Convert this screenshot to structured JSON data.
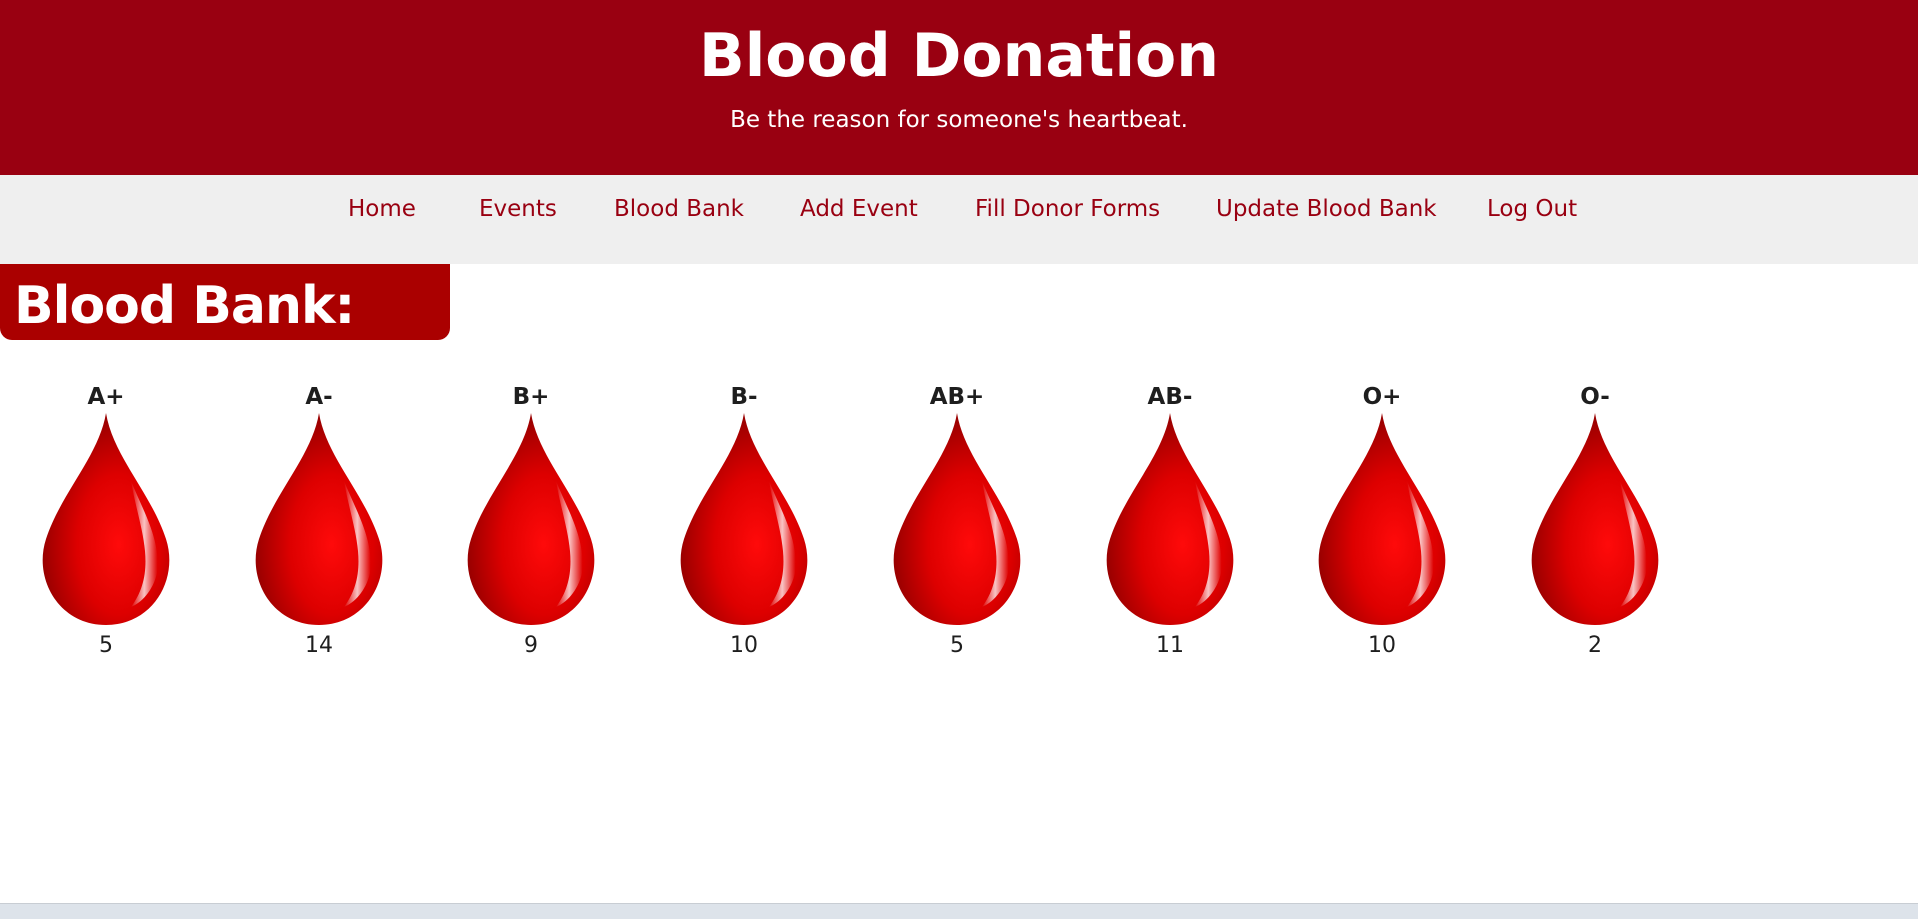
{
  "header": {
    "title": "Blood Donation",
    "subtitle": "Be the reason for someone's heartbeat."
  },
  "nav": {
    "items": [
      {
        "label": "Home"
      },
      {
        "label": "Events"
      },
      {
        "label": "Blood Bank"
      },
      {
        "label": "Add Event"
      },
      {
        "label": "Fill Donor Forms"
      },
      {
        "label": "Update Blood Bank"
      },
      {
        "label": "Log Out"
      }
    ]
  },
  "section": {
    "title": "Blood Bank:"
  },
  "blood_groups": [
    {
      "type": "A+",
      "count": "5"
    },
    {
      "type": "A-",
      "count": "14"
    },
    {
      "type": "B+",
      "count": "9"
    },
    {
      "type": "B-",
      "count": "10"
    },
    {
      "type": "AB+",
      "count": "5"
    },
    {
      "type": "AB-",
      "count": "11"
    },
    {
      "type": "O+",
      "count": "10"
    },
    {
      "type": "O-",
      "count": "2"
    }
  ],
  "icons": {
    "blood_drop": "blood-drop-icon"
  },
  "colors": {
    "header_bg": "#990011",
    "nav_bg": "#efefef",
    "nav_text": "#990011",
    "section_bg": "#aa0000",
    "drop_red": "#e00000"
  }
}
